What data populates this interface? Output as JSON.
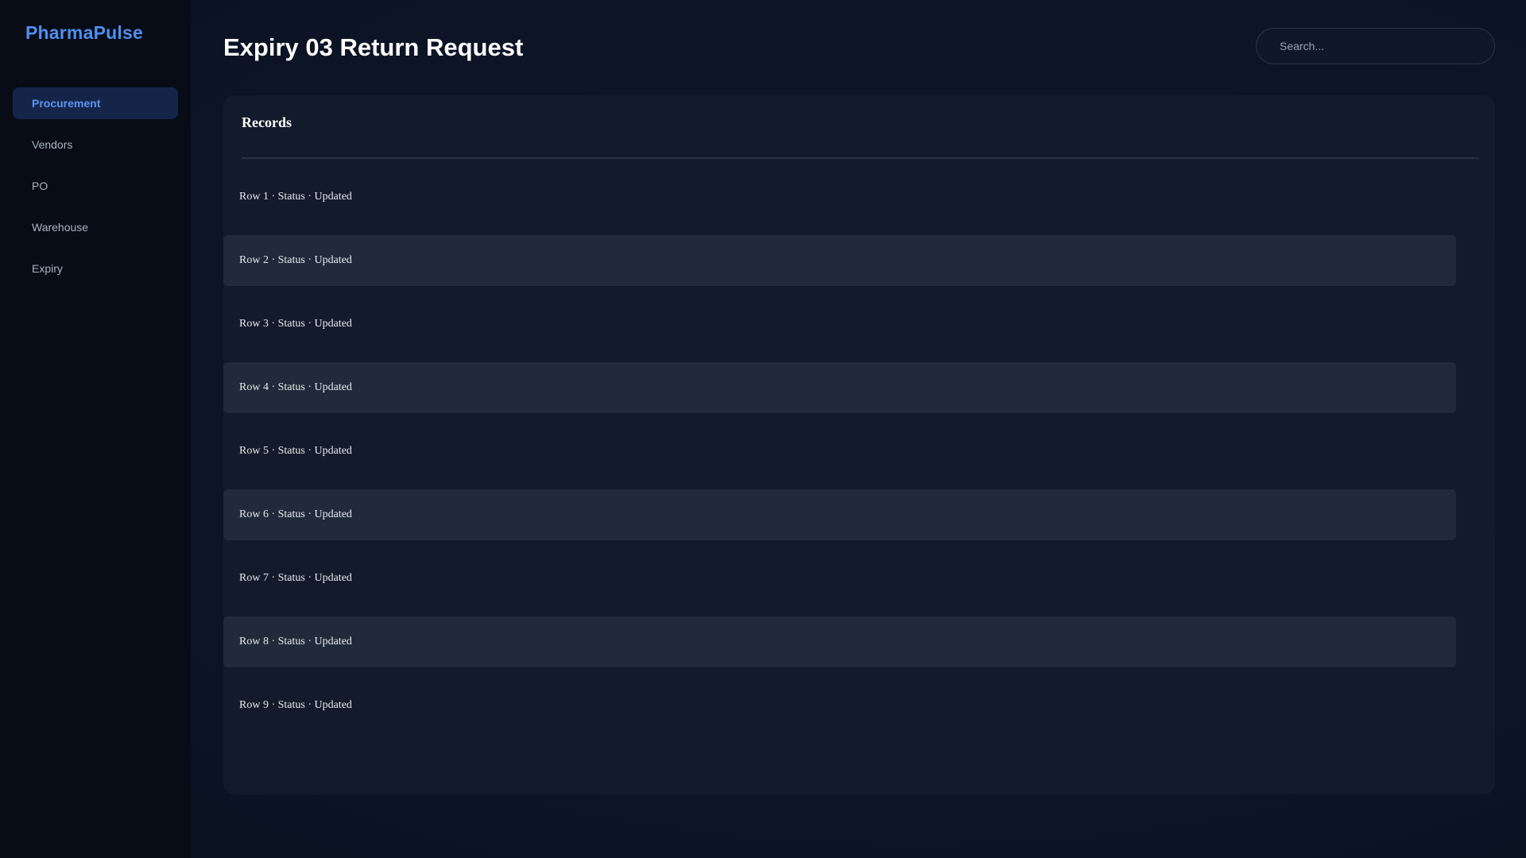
{
  "brand": {
    "name": "PharmaPulse"
  },
  "sidebar": {
    "items": [
      {
        "label": "Procurement",
        "active": true
      },
      {
        "label": "Vendors",
        "active": false
      },
      {
        "label": "PO",
        "active": false
      },
      {
        "label": "Warehouse",
        "active": false
      },
      {
        "label": "Expiry",
        "active": false
      }
    ]
  },
  "header": {
    "title": "Expiry 03 Return Request",
    "search_placeholder": "Search..."
  },
  "records": {
    "title": "Records",
    "rows": [
      "Row 1 · Status · Updated",
      "Row 2 · Status · Updated",
      "Row 3 · Status · Updated",
      "Row 4 · Status · Updated",
      "Row 5 · Status · Updated",
      "Row 6 · Status · Updated",
      "Row 7 · Status · Updated",
      "Row 8 · Status · Updated",
      "Row 9 · Status · Updated"
    ]
  },
  "colors": {
    "accent": "#4f8ff0",
    "active_nav_bg": "#15254a",
    "panel_bg": "#121a2b",
    "row_alt_bg": "#202a3a"
  }
}
